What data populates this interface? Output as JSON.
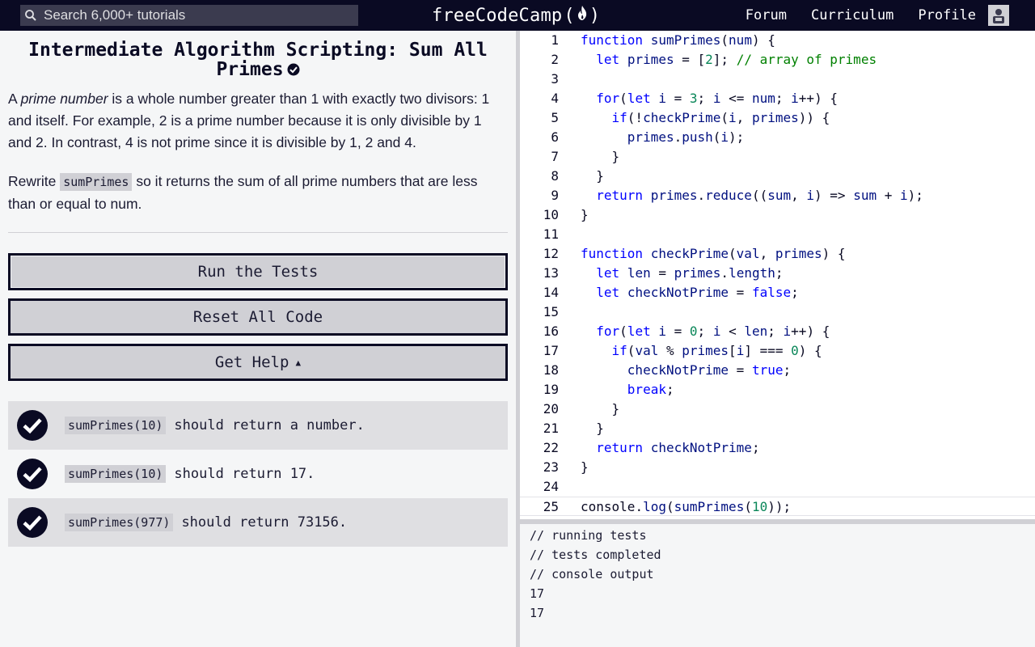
{
  "search": {
    "placeholder": "Search 6,000+ tutorials"
  },
  "logo": {
    "text": "freeCodeCamp"
  },
  "nav": {
    "links": [
      "Forum",
      "Curriculum",
      "Profile"
    ]
  },
  "challenge": {
    "title": "Intermediate Algorithm Scripting: Sum All Primes",
    "p1_a": "A ",
    "p1_em": "prime number",
    "p1_b": " is a whole number greater than 1 with exactly two divisors: 1 and itself. For example, 2 is a prime number because it is only divisible by 1 and 2. In contrast, 4 is not prime since it is divisible by 1, 2 and 4.",
    "p2_a": "Rewrite ",
    "p2_code": "sumPrimes",
    "p2_b": " so it returns the sum of all prime numbers that are less than or equal to num."
  },
  "buttons": {
    "run": "Run the Tests",
    "reset": "Reset All Code",
    "help": "Get Help"
  },
  "tests": [
    {
      "code": "sumPrimes(10)",
      "text": "should return a number."
    },
    {
      "code": "sumPrimes(10)",
      "text": "should return 17."
    },
    {
      "code": "sumPrimes(977)",
      "text": "should return 73156."
    }
  ],
  "editor": {
    "lines": [
      "function sumPrimes(num) {",
      "  let primes = [2]; // array of primes",
      "",
      "  for(let i = 3; i <= num; i++) {",
      "    if(!checkPrime(i, primes)) {",
      "      primes.push(i);",
      "    }",
      "  }",
      "  return primes.reduce((sum, i) => sum + i);",
      "}",
      "",
      "function checkPrime(val, primes) {",
      "  let len = primes.length;",
      "  let checkNotPrime = false;",
      "",
      "  for(let i = 0; i < len; i++) {",
      "    if(val % primes[i] === 0) {",
      "      checkNotPrime = true;",
      "      break;",
      "    }",
      "  }",
      "  return checkNotPrime;",
      "}",
      "",
      "console.log(sumPrimes(10));"
    ],
    "current_line": 25
  },
  "console": {
    "lines": [
      "// running tests",
      "// tests completed",
      "// console output",
      "17",
      "17"
    ]
  },
  "icons": {
    "search": "search-icon",
    "logo_flame": "fire-icon",
    "avatar": "avatar-icon",
    "test_pass": "check-circle-icon",
    "completed": "check-circle-icon"
  },
  "colors": {
    "nav_bg": "#0a0a23",
    "keyword": "#0000ff",
    "identifier": "#001080",
    "number": "#098658",
    "comment": "#008000"
  }
}
